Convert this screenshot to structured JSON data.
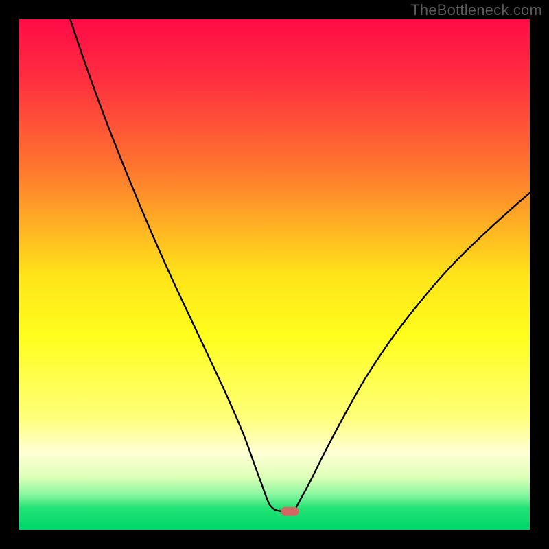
{
  "watermark": "TheBottleneck.com",
  "chart_data": {
    "type": "line",
    "title": "",
    "xlabel": "",
    "ylabel": "",
    "xlim": [
      0,
      100
    ],
    "ylim": [
      0,
      100
    ],
    "grid": false,
    "background": {
      "type": "vertical-gradient",
      "stops": [
        {
          "pos": 0.0,
          "color": "#ff0b47"
        },
        {
          "pos": 0.12,
          "color": "#ff2f3f"
        },
        {
          "pos": 0.3,
          "color": "#ff7a2e"
        },
        {
          "pos": 0.5,
          "color": "#ffe31a"
        },
        {
          "pos": 0.62,
          "color": "#fffe1c"
        },
        {
          "pos": 0.78,
          "color": "#ffff7a"
        },
        {
          "pos": 0.85,
          "color": "#ffffd6"
        },
        {
          "pos": 0.895,
          "color": "#dfffb8"
        },
        {
          "pos": 0.93,
          "color": "#8df7a1"
        },
        {
          "pos": 0.958,
          "color": "#22e274"
        },
        {
          "pos": 1.0,
          "color": "#00d66a"
        }
      ]
    },
    "series": [
      {
        "name": "bottleneck-curve",
        "color": "#000000",
        "points": [
          {
            "x": 10.0,
            "y": 100.0
          },
          {
            "x": 12.0,
            "y": 94.0
          },
          {
            "x": 15.0,
            "y": 85.5
          },
          {
            "x": 18.0,
            "y": 77.5
          },
          {
            "x": 22.0,
            "y": 67.5
          },
          {
            "x": 26.0,
            "y": 58.0
          },
          {
            "x": 30.0,
            "y": 49.0
          },
          {
            "x": 34.0,
            "y": 40.5
          },
          {
            "x": 38.0,
            "y": 32.0
          },
          {
            "x": 41.0,
            "y": 25.5
          },
          {
            "x": 44.0,
            "y": 18.5
          },
          {
            "x": 46.0,
            "y": 13.0
          },
          {
            "x": 48.0,
            "y": 7.5
          },
          {
            "x": 49.0,
            "y": 5.0
          },
          {
            "x": 50.0,
            "y": 4.0
          },
          {
            "x": 51.0,
            "y": 3.7
          },
          {
            "x": 52.2,
            "y": 3.6
          },
          {
            "x": 53.4,
            "y": 3.6
          },
          {
            "x": 54.0,
            "y": 4.0
          },
          {
            "x": 55.0,
            "y": 5.8
          },
          {
            "x": 57.0,
            "y": 9.5
          },
          {
            "x": 60.0,
            "y": 15.5
          },
          {
            "x": 64.0,
            "y": 23.0
          },
          {
            "x": 68.0,
            "y": 30.0
          },
          {
            "x": 73.0,
            "y": 37.5
          },
          {
            "x": 78.0,
            "y": 44.0
          },
          {
            "x": 84.0,
            "y": 51.0
          },
          {
            "x": 90.0,
            "y": 57.0
          },
          {
            "x": 96.0,
            "y": 62.5
          },
          {
            "x": 100.0,
            "y": 66.0
          }
        ]
      }
    ],
    "marker": {
      "name": "optimal-point",
      "x": 53.0,
      "y": 3.6,
      "color": "#cf6a62",
      "shape": "rounded-rect"
    }
  },
  "colors": {
    "frame": "#000000",
    "curve": "#000000",
    "marker": "#cf6a62",
    "watermark": "#5a5a5a"
  }
}
